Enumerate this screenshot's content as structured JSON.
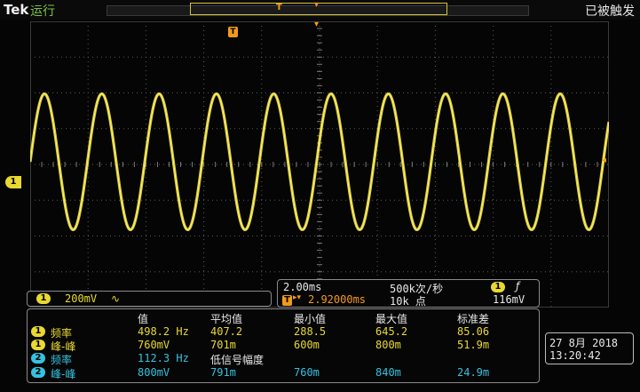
{
  "header": {
    "brand": "Tek",
    "run_state": "运行",
    "trigger_state": "已被触发",
    "record_trigger_label": "T"
  },
  "trigger": {
    "marker_label": "T",
    "level_marker": "◂"
  },
  "channel1": {
    "marker": "1",
    "badge": "1",
    "scale": "200mV",
    "coupling_symbol": "∿"
  },
  "timebase": {
    "scale": "2.00ms",
    "sample_rate": "500k次/秒",
    "trigger_channel_badge": "1",
    "trigger_slope": "ƒ",
    "trigger_badge": "T",
    "trigger_offset_arrow": "▸▾",
    "position": "2.92000ms",
    "record_length": "10k 点",
    "trigger_level": "116mV"
  },
  "measurements": {
    "headers": [
      "值",
      "平均值",
      "最小值",
      "最大值",
      "标准差"
    ],
    "rows": [
      {
        "channel": "1",
        "name": "频率",
        "value": "498.2 Hz",
        "mean": "407.2",
        "min": "288.5",
        "max": "645.2",
        "std": "85.06",
        "color": "yellow"
      },
      {
        "channel": "1",
        "name": "峰-峰",
        "value": "760mV",
        "mean": "701m",
        "min": "600m",
        "max": "800m",
        "std": "51.9m",
        "color": "yellow"
      },
      {
        "channel": "2",
        "name": "频率",
        "value": "112.3 Hz",
        "mean": "低信号幅度",
        "min": "",
        "max": "",
        "std": "",
        "color": "cyan"
      },
      {
        "channel": "2",
        "name": "峰-峰",
        "value": "800mV",
        "mean": "791m",
        "min": "760m",
        "max": "840m",
        "std": "24.9m",
        "color": "cyan"
      }
    ]
  },
  "datetime": {
    "date": "27 8月  2018",
    "time": "13:20:42"
  },
  "colors": {
    "ch1": "#e9d932",
    "ch2": "#35c2e0",
    "trigger": "#f39a1b",
    "background": "#050505",
    "grid": "#5a5a5a"
  },
  "waveform": {
    "channel": "1",
    "shape": "sine",
    "cycles_on_screen": 10.1,
    "amplitude_divisions": 1.9,
    "center_division": 0
  }
}
